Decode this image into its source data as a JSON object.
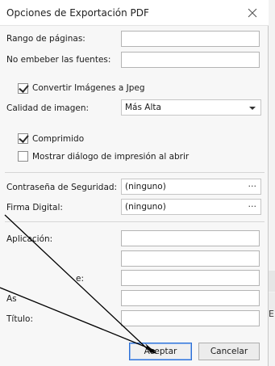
{
  "window": {
    "title": "Opciones de Exportación PDF",
    "close_icon": "close-icon"
  },
  "fields": {
    "page_range_label": "Rango de páginas:",
    "no_embed_fonts_label": "No embeber las fuentes:"
  },
  "options": {
    "convert_jpeg_label": "Convertir Imágenes a Jpeg",
    "convert_jpeg_checked": true,
    "image_quality_label": "Calidad de imagen:",
    "image_quality_value": "Más Alta",
    "compressed_label": "Comprimido",
    "compressed_checked": true,
    "show_print_dialog_label": "Mostrar diálogo de impresión al abrir",
    "show_print_dialog_checked": false
  },
  "security": {
    "password_label": "Contraseña de Seguridad:",
    "password_value": "(ninguno)",
    "signature_label": "Firma Digital:",
    "signature_value": "(ninguno)",
    "ellipsis": "···"
  },
  "metadata": {
    "application_label": "Aplicación:",
    "partial_label_e": "e:",
    "partial_label_as": "As",
    "title_label": "Título:"
  },
  "buttons": {
    "accept_label": "Aceptar",
    "cancel_label": "Cancelar"
  },
  "background": {
    "partial_letter": "E"
  }
}
